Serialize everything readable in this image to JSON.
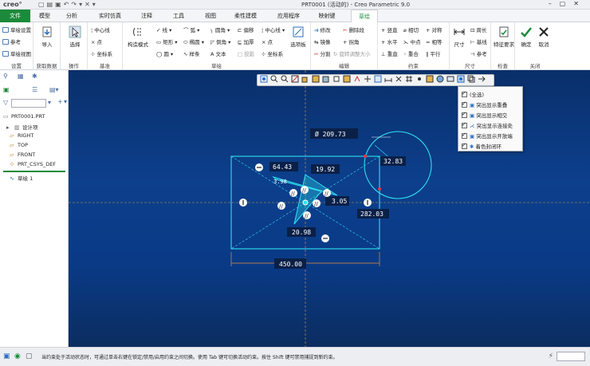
{
  "titlebar": {
    "logo": "creo°",
    "window_title": "PRT0001 (活动的) - Creo Parametric 9.0"
  },
  "tabs": [
    "文件",
    "模型",
    "分析",
    "实时仿真",
    "注释",
    "工具",
    "视图",
    "柔性建模",
    "应用程序",
    "映射键",
    "草绘"
  ],
  "ribbon": {
    "setup": {
      "label": "设置",
      "items": [
        "草绘设置",
        "参考",
        "草绘视图"
      ]
    },
    "getdata": {
      "label": "获取数据",
      "import": "导入"
    },
    "operations": {
      "label": "操作",
      "select": "选择"
    },
    "datum": {
      "label": "基准",
      "items": [
        "中心线",
        "点",
        "坐标系"
      ]
    },
    "sketch": {
      "label": "草绘",
      "construction": "构造模式",
      "col1": [
        "线",
        "矩形",
        "圆"
      ],
      "col2": [
        "弧",
        "椭圆",
        "样条"
      ],
      "col3": [
        "圆角",
        "倒角",
        "文本"
      ],
      "col4": [
        "偏移",
        "加厚",
        "投影"
      ],
      "col5": [
        "中心线",
        "点",
        "坐标系"
      ],
      "palette": "选项板"
    },
    "edit": {
      "label": "编辑",
      "items": [
        "修改",
        "删除段",
        "镜像",
        "拐角",
        "分割",
        "旋转调整大小"
      ]
    },
    "constrain": {
      "label": "约束",
      "items": [
        "竖直",
        "相切",
        "对称",
        "水平",
        "中点",
        "相等",
        "重直",
        "重合",
        "平行"
      ]
    },
    "dimension": {
      "label": "尺寸",
      "dim": "尺寸",
      "items": [
        "周长",
        "基线",
        "参考"
      ]
    },
    "inspect": {
      "label": "检查",
      "feature_req": "特征要求"
    },
    "close": {
      "label": "关闭",
      "ok": "确定",
      "cancel": "取消"
    }
  },
  "tree": {
    "items": [
      "PRT0001.PRT",
      "设计项",
      "RIGHT",
      "TOP",
      "FRONT",
      "PRT_CSYS_DEF",
      "草绘 1"
    ]
  },
  "canvas": {
    "dims": [
      "Ø 209.73",
      "64.43",
      "19.92",
      "32.83",
      "3.98",
      "3.05",
      "282.03",
      "20.98",
      "450.00"
    ]
  },
  "dropmenu": {
    "items": [
      "(全选)",
      "突出显示重叠",
      "突出显示相交",
      "突出显示连接处",
      "突出显示开放端",
      "着色封闭环"
    ]
  },
  "status": {
    "text": "当约束处于活动状态时，可通过单击右键在锁定/禁用/启用约束之间切换。使用 Tab 键可切换活动约束。按住 Shift 键可禁用捕捉到新约束。"
  },
  "colors": {
    "file_tab": "#1c8a3a",
    "sketch_cyan": "#2ee0f0",
    "canvas_top": "#0a2f6a",
    "accent_red": "#e23c3c"
  }
}
